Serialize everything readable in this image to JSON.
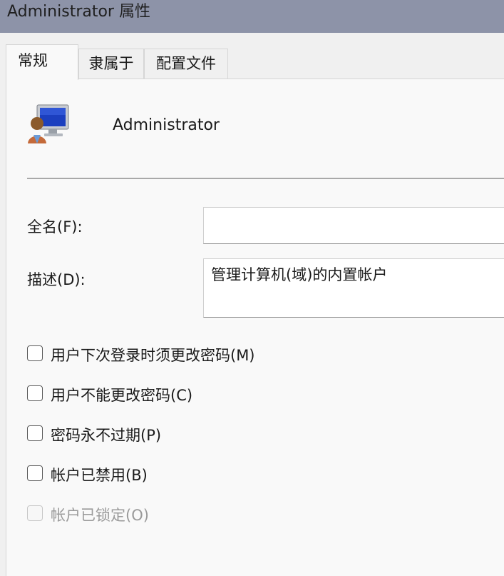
{
  "window": {
    "title": "Administrator 属性"
  },
  "tabs": [
    {
      "label": "常规",
      "active": true
    },
    {
      "label": "隶属于",
      "active": false
    },
    {
      "label": "配置文件",
      "active": false
    }
  ],
  "general": {
    "user_icon": "user-computer-icon",
    "username": "Administrator",
    "fullname": {
      "label": "全名(F):",
      "value": ""
    },
    "description": {
      "label": "描述(D):",
      "value": "管理计算机(域)的内置帐户"
    },
    "checkboxes": [
      {
        "label": "用户下次登录时须更改密码(M)",
        "checked": false,
        "enabled": true
      },
      {
        "label": "用户不能更改密码(C)",
        "checked": false,
        "enabled": true
      },
      {
        "label": "密码永不过期(P)",
        "checked": false,
        "enabled": true
      },
      {
        "label": "帐户已禁用(B)",
        "checked": false,
        "enabled": true
      },
      {
        "label": "帐户已锁定(O)",
        "checked": false,
        "enabled": false
      }
    ]
  },
  "colors": {
    "titlebar": "#8d93a8",
    "panel": "#f9f9f9",
    "background": "#f0f0f0"
  }
}
